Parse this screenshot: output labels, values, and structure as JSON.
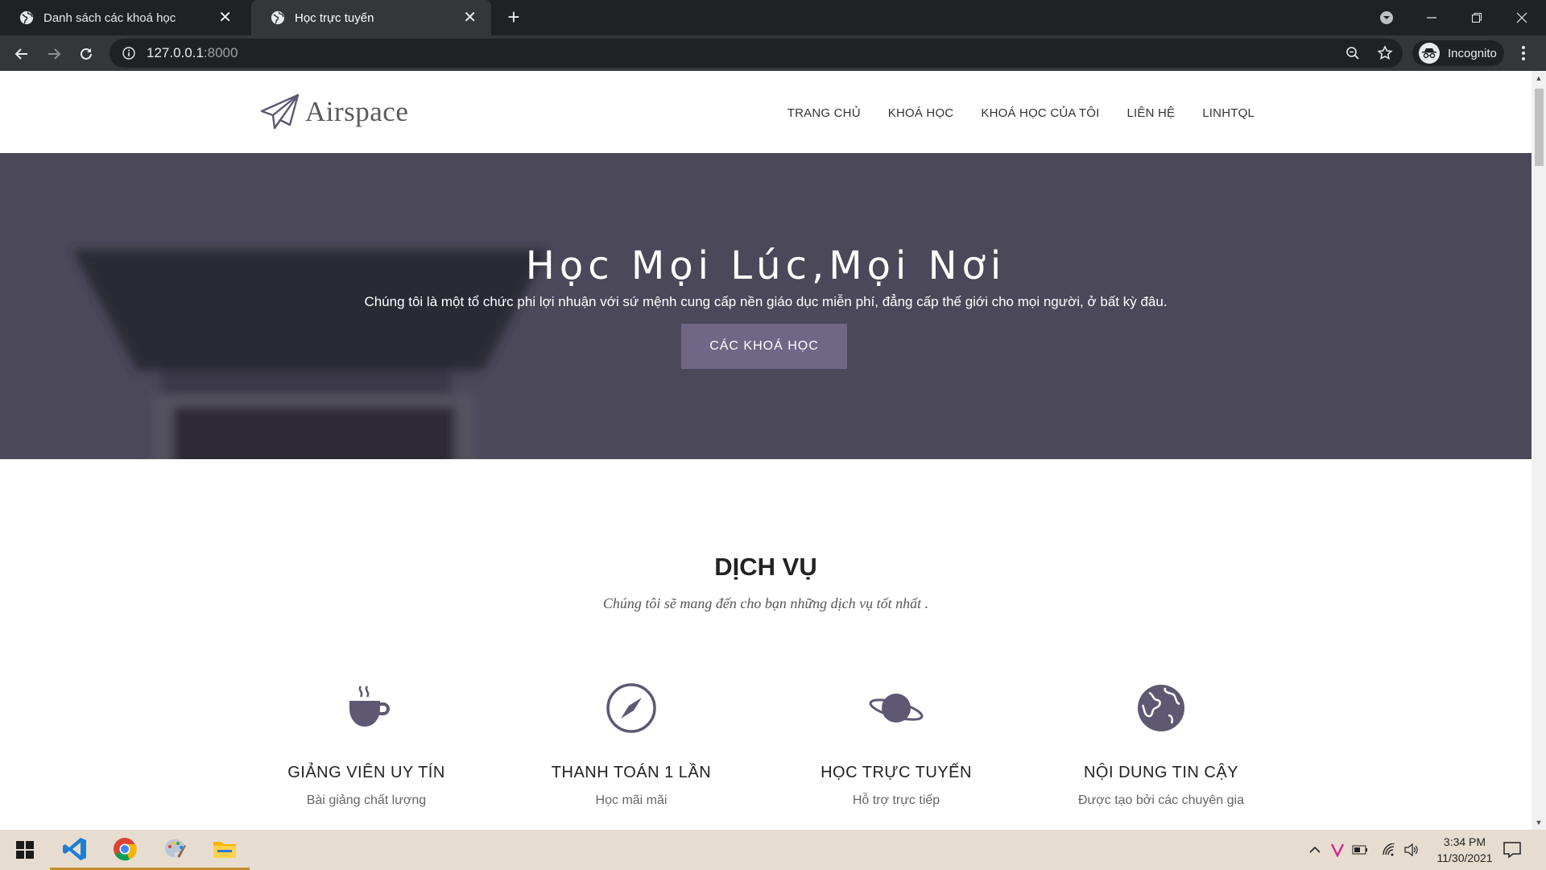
{
  "browser": {
    "tabs": [
      {
        "title": "Danh sách các khoá học",
        "active": false
      },
      {
        "title": "Học trực tuyến",
        "active": true
      }
    ],
    "url_host": "127.0.0.1",
    "url_port": ":8000",
    "profile_label": "Incognito"
  },
  "site": {
    "brand": "Airspace",
    "nav": [
      "TRANG CHỦ",
      "KHOÁ HỌC",
      "KHOÁ HỌC CỦA TÔI",
      "LIÊN HỆ",
      "LINHTQL"
    ]
  },
  "hero": {
    "title": "Học Mọi Lúc,Mọi Nơi",
    "subtitle": "Chúng tôi là một tổ chức phi lợi nhuận với sứ mệnh cung cấp nền giáo dục miễn phí, đẳng cấp thế giới cho mọi người, ở bất kỳ đâu.",
    "button": "CÁC KHOÁ HỌC"
  },
  "services": {
    "title": "DỊCH VỤ",
    "subtitle": "Chúng tôi sẽ mang đến cho bạn những dịch vụ tốt nhất .",
    "items": [
      {
        "icon": "coffee-cup-icon",
        "title": "GIẢNG VIÊN UY TÍN",
        "desc": "Bài giảng chất lượng"
      },
      {
        "icon": "compass-icon",
        "title": "THANH TOÁN 1 LẦN",
        "desc": "Học mãi mãi"
      },
      {
        "icon": "planet-icon",
        "title": "HỌC TRỰC TUYẾN",
        "desc": "Hỗ trợ trực tiếp"
      },
      {
        "icon": "globe-icon",
        "title": "NỘI DUNG TIN CẬY",
        "desc": "Được tạo bởi các chuyên gia"
      }
    ]
  },
  "taskbar": {
    "time": "3:34 PM",
    "date": "11/30/2021"
  },
  "colors": {
    "hero_bg": "#4b4859",
    "accent": "#6f6785",
    "icon": "#5e5873"
  }
}
